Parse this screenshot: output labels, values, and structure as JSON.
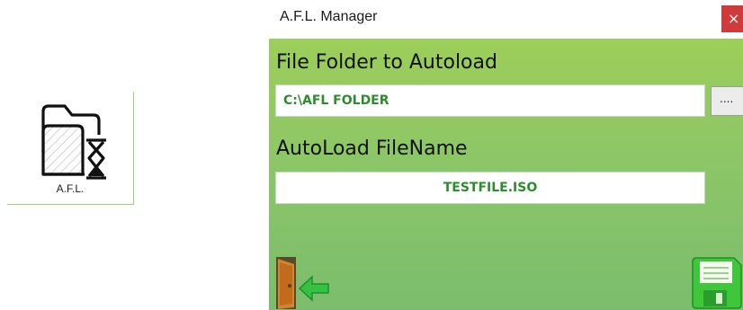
{
  "desktop_icon": {
    "label": "A.F.L.",
    "icon": "folder-hourglass-icon"
  },
  "window": {
    "title": "A.F.L. Manager",
    "close_label": "×",
    "folder_section": {
      "heading": "File Folder to Autoload",
      "value": "C:\\AFL FOLDER",
      "browse_label": "...."
    },
    "filename_section": {
      "heading": "AutoLoad FileName",
      "value": "TESTFILE.ISO"
    },
    "icons": {
      "exit": "exit-door-icon",
      "save": "save-disk-icon"
    },
    "colors": {
      "background_top": "#9dce5a",
      "background_bottom": "#7bbd6d",
      "value_text": "#2d8c2d",
      "close": "#cf3b3b"
    }
  }
}
